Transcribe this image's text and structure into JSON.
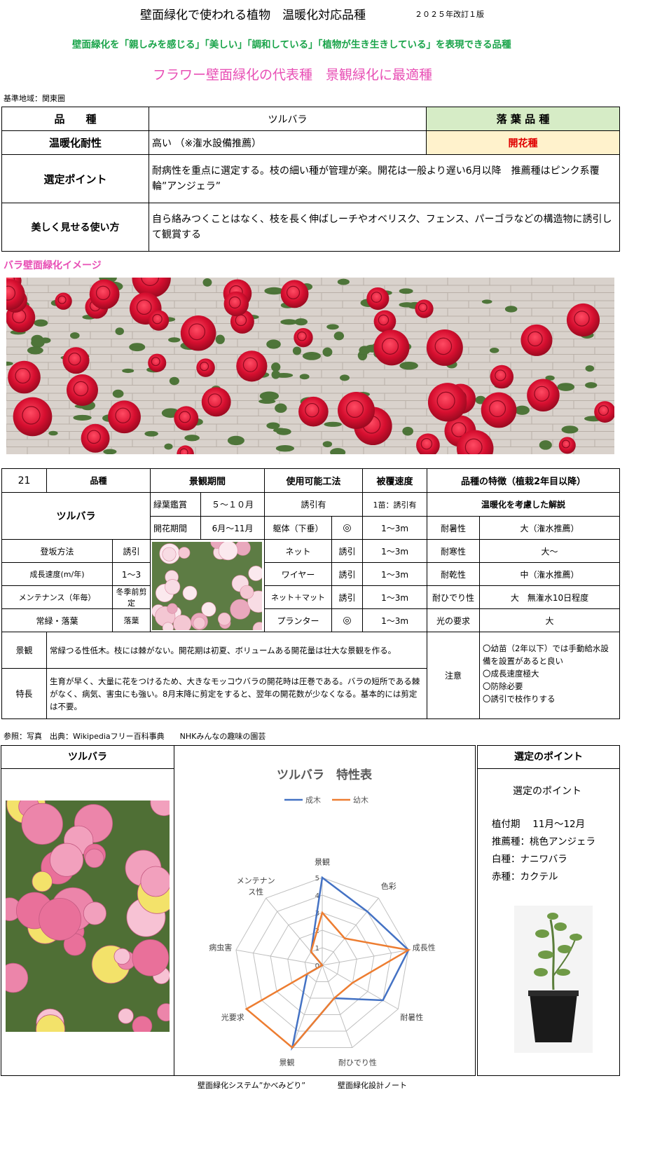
{
  "header": {
    "title": "壁面緑化で使われる植物　温暖化対応品種",
    "edition": "２０２５年改訂１版",
    "subtitle_green": "壁面緑化を「親しみを感じる」「美しい」「調和している」「植物が生き生きしている」を表現できる品種",
    "subtitle_pink": "フラワー壁面緑化の代表種　景観緑化に最適種",
    "region": "基準地域：関東圏"
  },
  "top_table": {
    "variety_label": "品　　種",
    "variety_value": "ツルバラ",
    "leaf_type": "落 葉 品 種",
    "heat_label": "温暖化耐性",
    "heat_value": "高い （※潅水設備推薦）",
    "flowering": "開花種",
    "point_label": "選定ポイント",
    "point_value": "耐病性を重点に選定する。枝の細い種が管理が楽。開花は一般より遅い6月以降　推薦種はピンク系覆輪”アンジェラ”",
    "usage_label": "美しく見せる使い方",
    "usage_value": "自ら絡みつくことはなく、枝を長く伸ばしーチやオベリスク、フェンス、パーゴラなどの構造物に誘引して観賞する"
  },
  "image_section_title": "バラ壁面緑化イメージ",
  "spec": {
    "number": "21",
    "variety_head": "品種",
    "period_head": "景観期間",
    "method_head": "使用可能工法",
    "speed_head": "被覆速度",
    "feature_head": "品種の特徴（植栽2年目以降）",
    "variety_name": "ツルバラ",
    "foliage_label": "緑葉鑑賞",
    "foliage_value": "５～１０月",
    "bloom_label": "開花期間",
    "bloom_value": "6月～11月",
    "induce_head": "誘引有",
    "induce_speed": "1苗：誘引有",
    "warming_head": "温暖化を考慮した解説",
    "left_rows": [
      {
        "label": "登坂方法",
        "value": "誘引"
      },
      {
        "label": "成長速度(m/年)",
        "value": "1～3"
      },
      {
        "label": "メンテナンス（年毎）",
        "value": "冬季前剪定"
      },
      {
        "label": "常緑・落葉",
        "value": "落葉"
      }
    ],
    "method_rows": [
      {
        "name": "躯体（下垂）",
        "mark": "◎",
        "speed": "1～3m"
      },
      {
        "name": "ネット",
        "mark": "誘引",
        "speed": "1～3m"
      },
      {
        "name": "ワイヤー",
        "mark": "誘引",
        "speed": "1～3m"
      },
      {
        "name": "ネット＋マット",
        "mark": "誘引",
        "speed": "1～3m"
      },
      {
        "name": "プランター",
        "mark": "◎",
        "speed": "1～3m"
      }
    ],
    "feature_rows": [
      {
        "label": "耐暑性",
        "value": "大（潅水推薦）"
      },
      {
        "label": "耐寒性",
        "value": "大～"
      },
      {
        "label": "耐乾性",
        "value": "中（潅水推薦）"
      },
      {
        "label": "耐ひでり性",
        "value": "大　無潅水10日程度"
      },
      {
        "label": "光の要求",
        "value": "大"
      }
    ],
    "scenery_label": "景観",
    "scenery_text": "常緑つる性低木。枝には棘がない。開花期は初夏、ボリュームある開花量は壮大な景観を作る。",
    "trait_label": "特長",
    "trait_text": "生育が早く、大量に花をつけるため、大きなモッコウバラの開花時は圧巻である。バラの短所である棘がなく、病気、害虫にも強い。8月末降に剪定をすると、翌年の開花数が少なくなる。基本的には剪定は不要。",
    "caution_label": "注意",
    "caution_items": [
      "〇幼苗（2年以下）では手動給水設備を設置があると良い",
      "〇成長速度極大",
      "〇防除必要",
      "〇誘引で枝作りする"
    ]
  },
  "reference": "参照：写真　出典：Wikipediaフリー百科事典　　NHKみんなの趣味の園芸",
  "bottom": {
    "left_title": "ツルバラ",
    "right_title": "選定のポイント",
    "point_heading": "選定のポイント",
    "point_lines": [
      "植付期　 11月～12月",
      "推薦種：桃色アンジェラ",
      "白種：ナニワバラ",
      "赤種：カクテル"
    ]
  },
  "chart_data": {
    "type": "radar",
    "title": "ツルバラ　特性表",
    "axes": [
      "景観",
      "色彩",
      "成長性",
      "耐暑性",
      "耐ひでり性",
      "景観",
      "光要求",
      "病虫害",
      "メンテナンス性"
    ],
    "rmax": 5,
    "tick_labels": [
      "0",
      "1",
      "2",
      "3",
      "4",
      "5"
    ],
    "legend_position": "top",
    "series": [
      {
        "name": "成木",
        "color": "#4472C4",
        "values": [
          5,
          4,
          5,
          4,
          2,
          5,
          1,
          0,
          1
        ]
      },
      {
        "name": "幼木",
        "color": "#ED7D31",
        "values": [
          3,
          2,
          5,
          2,
          2,
          5,
          5,
          0,
          1
        ]
      }
    ]
  },
  "footer": {
    "left": "壁面緑化システム”かべみどり”",
    "right": "壁面緑化設計ノート"
  }
}
